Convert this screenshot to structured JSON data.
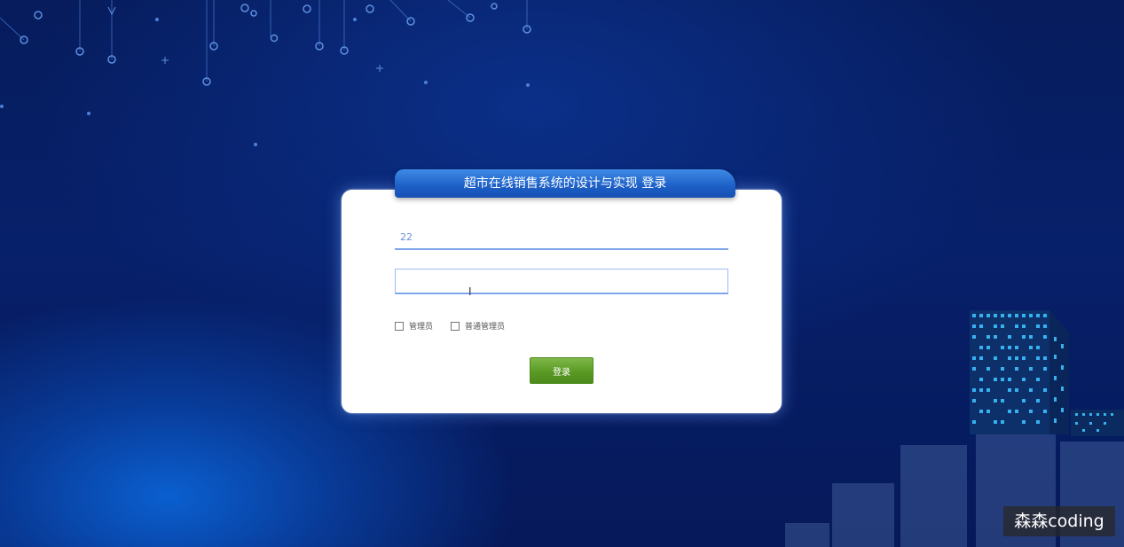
{
  "panel": {
    "title": "超市在线销售系统的设计与实现 登录"
  },
  "form": {
    "username_value": "22",
    "password_value": "",
    "roles": [
      {
        "label": "管理员",
        "checked": false
      },
      {
        "label": "普通管理员",
        "checked": false
      }
    ],
    "login_label": "登录"
  },
  "watermark": {
    "text": "森森coding"
  },
  "colors": {
    "accent": "#1c5fc7",
    "button": "#5a9a24",
    "background": "#07206a"
  }
}
